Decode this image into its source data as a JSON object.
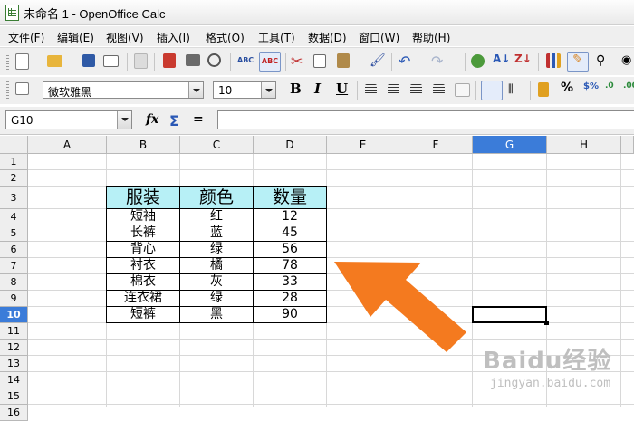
{
  "window": {
    "title": "未命名 1 - OpenOffice Calc"
  },
  "menu": [
    "文件(F)",
    "编辑(E)",
    "视图(V)",
    "插入(I)",
    "格式(O)",
    "工具(T)",
    "数据(D)",
    "窗口(W)",
    "帮助(H)"
  ],
  "format_bar": {
    "font_name": "微软雅黑",
    "font_size": "10",
    "bold": "B",
    "italic": "I",
    "underline": "U",
    "percent": "%"
  },
  "formula_bar": {
    "name_box": "G10",
    "function_wizard": "fx",
    "sum": "Σ",
    "equals": "=",
    "content": ""
  },
  "sheet": {
    "columns": [
      "A",
      "B",
      "C",
      "D",
      "E",
      "F",
      "G",
      "H"
    ],
    "selected_column": "G",
    "rows": [
      "1",
      "2",
      "3",
      "4",
      "5",
      "6",
      "7",
      "8",
      "9",
      "10",
      "11",
      "12",
      "13",
      "14",
      "15",
      "16"
    ],
    "selected_row": "10",
    "active_cell": "G10",
    "table": {
      "headers": [
        "服装",
        "颜色",
        "数量"
      ],
      "rows": [
        [
          "短袖",
          "红",
          "12"
        ],
        [
          "长裤",
          "蓝",
          "45"
        ],
        [
          "背心",
          "绿",
          "56"
        ],
        [
          "衬衣",
          "橘",
          "78"
        ],
        [
          "棉衣",
          "灰",
          "33"
        ],
        [
          "连衣裙",
          "绿",
          "28"
        ],
        [
          "短裤",
          "黑",
          "90"
        ]
      ]
    }
  },
  "annotation": {
    "arrow_color": "#f47a1f",
    "arrow_direction": "up-left"
  },
  "watermark": {
    "text": "Baidu经验",
    "sub": "jingyan.baidu.com"
  },
  "colors": {
    "header_fill": "#b7f0f6",
    "selection": "#3b7cd9"
  }
}
